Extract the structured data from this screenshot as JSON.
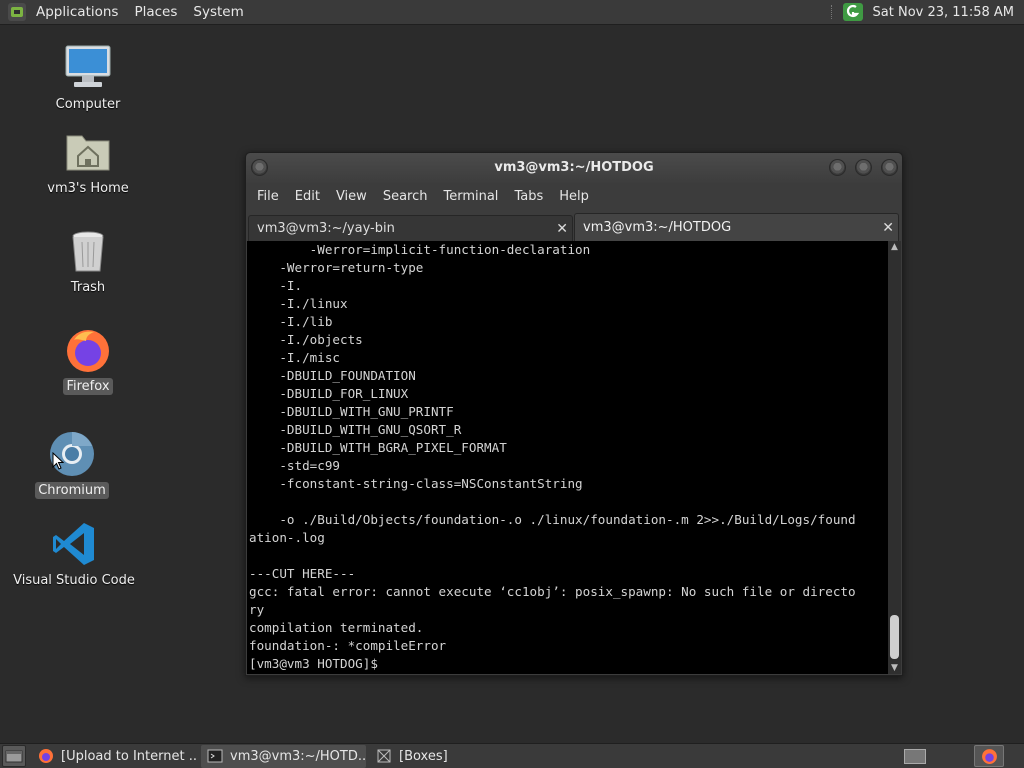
{
  "top_panel": {
    "menus": [
      "Applications",
      "Places",
      "System"
    ],
    "clock": "Sat Nov 23, 11:58 AM"
  },
  "desktop": {
    "icons": [
      {
        "label": "Computer",
        "icon": "computer-icon"
      },
      {
        "label": "vm3's Home",
        "icon": "home-folder-icon"
      },
      {
        "label": "Trash",
        "icon": "trash-icon"
      },
      {
        "label": "Firefox",
        "icon": "firefox-icon"
      },
      {
        "label": "Chromium",
        "icon": "chromium-icon"
      },
      {
        "label": "Visual Studio Code",
        "icon": "vscode-icon"
      }
    ]
  },
  "terminal": {
    "title": "vm3@vm3:~/HOTDOG",
    "menu": [
      "File",
      "Edit",
      "View",
      "Search",
      "Terminal",
      "Tabs",
      "Help"
    ],
    "tabs": [
      {
        "label": "vm3@vm3:~/yay-bin",
        "active": false
      },
      {
        "label": "vm3@vm3:~/HOTDOG",
        "active": true
      }
    ],
    "lines": [
      "        -Werror=implicit-function-declaration",
      "    -Werror=return-type",
      "    -I.",
      "    -I./linux",
      "    -I./lib",
      "    -I./objects",
      "    -I./misc",
      "    -DBUILD_FOUNDATION",
      "    -DBUILD_FOR_LINUX",
      "    -DBUILD_WITH_GNU_PRINTF",
      "    -DBUILD_WITH_GNU_QSORT_R",
      "    -DBUILD_WITH_BGRA_PIXEL_FORMAT",
      "    -std=c99",
      "    -fconstant-string-class=NSConstantString",
      "",
      "    -o ./Build/Objects/foundation-.o ./linux/foundation-.m 2>>./Build/Logs/found",
      "ation-.log",
      "",
      "---CUT HERE---",
      "gcc: fatal error: cannot execute ‘cc1obj’: posix_spawnp: No such file or directo",
      "ry",
      "compilation terminated.",
      "foundation-: *compileError",
      "[vm3@vm3 HOTDOG]$ "
    ]
  },
  "taskbar": {
    "tasks": [
      {
        "label": "[Upload to Internet ...",
        "icon": "firefox-icon",
        "active": false
      },
      {
        "label": "vm3@vm3:~/HOTD...",
        "icon": "terminal-icon",
        "active": true
      },
      {
        "label": "[Boxes]",
        "icon": "boxes-icon",
        "active": false
      }
    ]
  },
  "colors": {
    "desktop_bg": "#2b2b2b",
    "panel_bg": "#3a3a3a",
    "terminal_bg": "#000000",
    "terminal_fg": "#d4d4d4"
  }
}
